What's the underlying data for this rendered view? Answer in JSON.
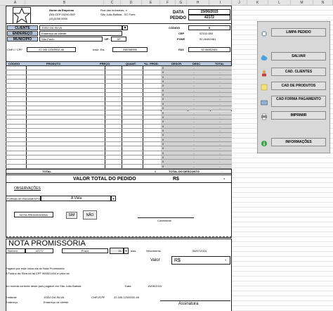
{
  "columns": [
    "A",
    "B",
    "C",
    "D",
    "E",
    "F",
    "G",
    "H",
    "I",
    "J",
    "K",
    "L",
    "M",
    "N"
  ],
  "company": {
    "name": "Nome da Empresa",
    "phone1": "(59) CEP 03240-000",
    "phone2": "(41)3265 0000",
    "address": "Rua das Industrias, n",
    "city": "São João Batista - SC Fone"
  },
  "header": {
    "data_label": "DATA",
    "data_value": "15/06/2015",
    "pedido_label": "PEDIDO",
    "pedido_value": "42172",
    "codigo_label": "CÓDIGO",
    "codigo_value": "5",
    "cep_label": "CEP",
    "cep_value": "02102-650",
    "fone_label": "FONE",
    "fone_value": "52.46462481",
    "fax_label": "FAX",
    "fax_value": "52.46462481"
  },
  "client": {
    "cliente_label": "CLIENTE",
    "cliente_value": "JOÃO DA SILVA",
    "endereco_label": "ENDEREÇO",
    "endereco_value": "Endereço de cliente",
    "municipio_label": "MUNICÍPIO",
    "municipio_value": "São Paulo",
    "uf_label": "UF:",
    "uf_value": "SP",
    "cnpj_label": "CNPJ / CPF",
    "cnpj_value": "22.345.123/0002-48",
    "insc_label": "Inscr. Est.",
    "insc_value": "256786990"
  },
  "table": {
    "headers": [
      "CÓDIGO",
      "PRODUTO",
      "PREÇO",
      "QUANT.",
      "%L. PROD.",
      "DESCR.",
      "DESC",
      "TOTAL"
    ],
    "rows": [
      [
        "0",
        "-",
        "-",
        "-"
      ],
      [
        "0",
        "-",
        "-",
        "-"
      ],
      [
        "0",
        "-",
        "-",
        "-"
      ],
      [
        "0",
        "-",
        "-",
        "-"
      ],
      [
        "0",
        "-",
        "-",
        "-"
      ],
      [
        "0",
        "-",
        "-",
        "-"
      ],
      [
        "0",
        "-",
        "-",
        "-"
      ],
      [
        "0",
        "-",
        "-",
        "-"
      ],
      [
        "0",
        "-",
        "-",
        "-"
      ],
      [
        "0",
        "-",
        "-",
        "-"
      ],
      [
        "0",
        "-",
        "-",
        "-"
      ],
      [
        "0",
        "-",
        "-",
        "-"
      ],
      [
        "0",
        "-",
        "-",
        "-"
      ],
      [
        "0",
        "-",
        "-",
        "-"
      ],
      [
        "0",
        "-",
        "-",
        "-"
      ],
      [
        "0",
        "-",
        "-",
        "-"
      ],
      [
        "0",
        "-",
        "-",
        "-"
      ],
      [
        "0",
        "-",
        "-",
        "-"
      ],
      [
        "0",
        "-",
        "-",
        "-"
      ],
      [
        "0",
        "-",
        "-",
        "-"
      ],
      [
        "0",
        "-",
        "-",
        "-"
      ],
      [
        "0",
        "-",
        "-",
        "-"
      ],
      [
        "0",
        "-",
        "-",
        "-"
      ]
    ],
    "total_label": "TOTAL",
    "total_zero": "0",
    "total_desconto_label": "TOTAL DO DESCONTO",
    "total_desconto_value": "-"
  },
  "summary": {
    "valor_total_label": "VALOR TOTAL DO PEDIDO",
    "currency": "R$",
    "valor_total_value": "-"
  },
  "observacoes_label": "OBSERVAÇÕES",
  "forma_pagamento": {
    "label": "FORMA DE PAGAMENTO",
    "value": "A Vista"
  },
  "nota_promissoria_small": "NOTA PROMISSÓRIA",
  "sim_label": "SIM",
  "nao_label": "NÃO",
  "conferente_label": "Conferente",
  "side_buttons": {
    "limpa": "LIMPA PEDIDO",
    "salvar": "SALVAR",
    "clientes": "CAD. CLIENTES",
    "produtos": "CAD DE PRODUTOS",
    "pagamento": "CAD FORMA PAGAMENTO",
    "imprimir": "IMPRIMIR",
    "informacoes": "INFORMAÇÕES"
  },
  "promissoria": {
    "title": "NOTA PROMISSÓRIA",
    "numero_label": "Número",
    "numero_value": "42172",
    "prazo_label": "Prazo",
    "prazo_value": "21",
    "dias_label": "dias",
    "vencimento_label": "Vencimento",
    "vencimento_value": "06/07/2015",
    "valor_label": "Valor",
    "valor_currency": "R$",
    "valor_value": "-",
    "text1": "Pagarei por esta única via de Nota Promissória",
    "text2": "A Fulano da Silva tal tal CPF 965521454 a valor de",
    "text3": "em moeda corrente deste país     pagável em São João Batista",
    "data_label": "Data",
    "data_value": "15/06/2015",
    "emitente_label": "Emitente",
    "emitente_value": "JOÃO DA SILVA",
    "cnpj_label": "CNPJ/CPF",
    "cnpj_value": "22.345.123/0002-48",
    "endereco_label": "Endereço",
    "endereco_value": "Endereço de cliente",
    "assinatura_label": "Assinatura"
  }
}
